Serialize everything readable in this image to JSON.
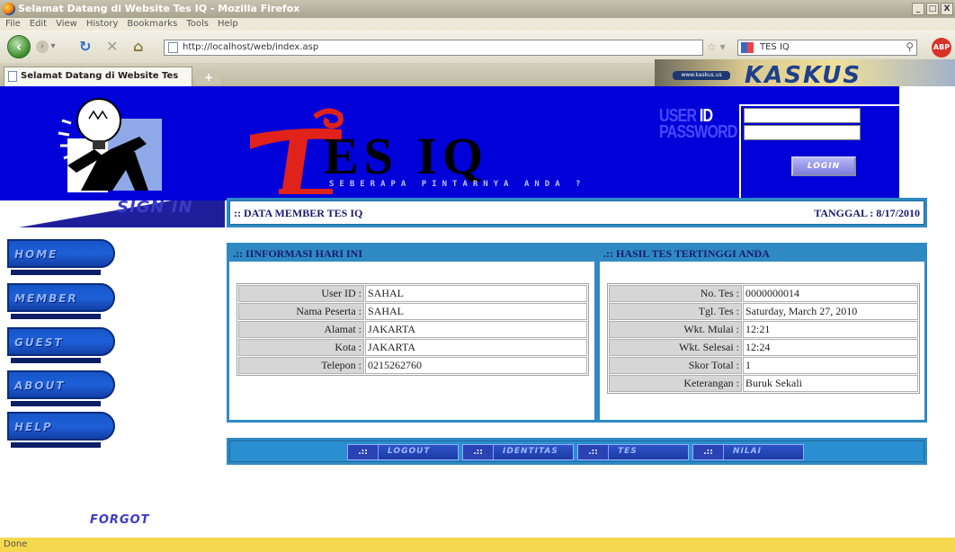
{
  "browser": {
    "window_title": "Selamat Datang di Website Tes IQ - Mozilla Firefox",
    "window_buttons": [
      "_",
      "□",
      "X"
    ],
    "menu": [
      "File",
      "Edit",
      "View",
      "History",
      "Bookmarks",
      "Tools",
      "Help"
    ],
    "url": "http://localhost/web/index.asp",
    "search_value": "TES IQ",
    "tab_title": "Selamat Datang di Website Tes IQ",
    "new_tab_label": "+",
    "addon_label": "ABP",
    "ad_url": "www.kaskus.us",
    "ad_text": "KASKUS",
    "status": "Done"
  },
  "header": {
    "title": "ES IQ",
    "tagline": "SEBERAPA PINTARNYA ANDA ?",
    "login": {
      "user_id_label_dim": "USER",
      "user_id_label_bright": " ID",
      "password_label": "PASSWORD",
      "user_id_value": "",
      "password_value": "",
      "login_button": "LOGIN"
    },
    "sign_in": "SIGN IN"
  },
  "member_bar": {
    "title": ":: DATA MEMBER TES IQ",
    "date": "TANGGAL : 8/17/2010"
  },
  "side_nav": [
    "HOME",
    "MEMBER",
    "GUEST",
    "ABOUT",
    "HELP"
  ],
  "info_panel": {
    "title": ".:: IINFORMASI HARI INI",
    "rows": [
      {
        "label": "User ID :",
        "value": "SAHAL"
      },
      {
        "label": "Nama Peserta :",
        "value": "SAHAL"
      },
      {
        "label": "Alamat :",
        "value": "JAKARTA"
      },
      {
        "label": "Kota :",
        "value": "JAKARTA"
      },
      {
        "label": "Telepon :",
        "value": "0215262760"
      }
    ]
  },
  "result_panel": {
    "title": ".:: HASIL TES TERTINGGI ANDA",
    "rows": [
      {
        "label": "No. Tes :",
        "value": "0000000014"
      },
      {
        "label": "Tgl. Tes :",
        "value": "Saturday, March 27, 2010"
      },
      {
        "label": "Wkt. Mulai :",
        "value": "12:21"
      },
      {
        "label": "Wkt. Selesai :",
        "value": "12:24"
      },
      {
        "label": "Skor Total :",
        "value": "1"
      },
      {
        "label": "Keterangan :",
        "value": "Buruk Sekali"
      }
    ]
  },
  "bottom_nav": {
    "marker": ".::",
    "items": [
      "LOGOUT",
      "IDENTITAS",
      "TES",
      "NILAI"
    ]
  },
  "forgot": "FORGOT",
  "colors": {
    "header_blue": "#0000d8",
    "panel_blue": "#2f8ac4",
    "logo_red": "#e0221a"
  }
}
